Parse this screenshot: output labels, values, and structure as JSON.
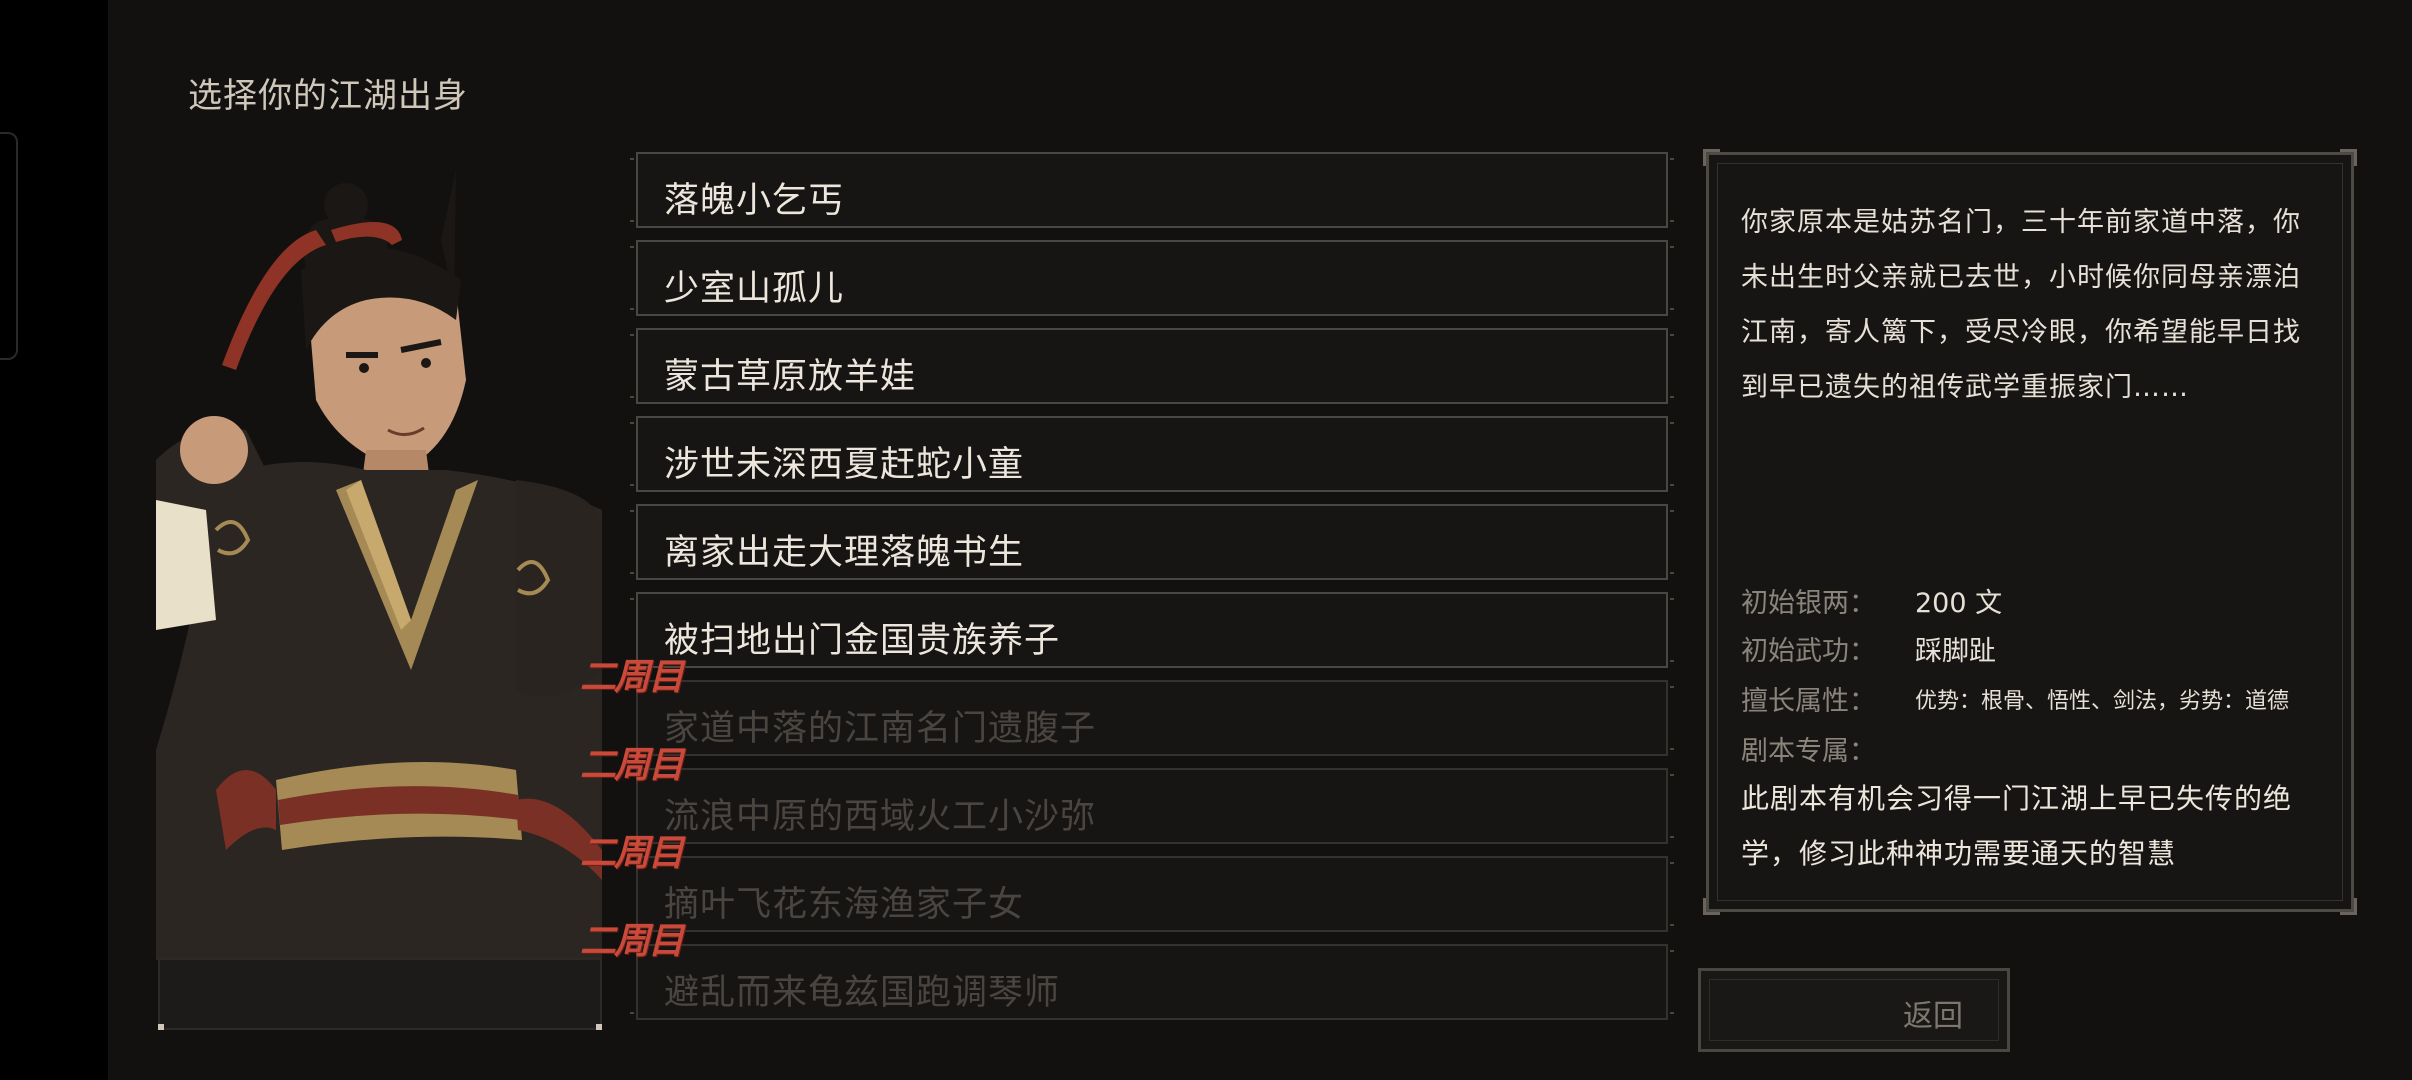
{
  "screen": {
    "title": "选择你的江湖出身"
  },
  "origins": [
    {
      "label": "落魄小乞丐",
      "locked": false,
      "badge": ""
    },
    {
      "label": "少室山孤儿",
      "locked": false,
      "badge": ""
    },
    {
      "label": "蒙古草原放羊娃",
      "locked": false,
      "badge": ""
    },
    {
      "label": "涉世未深西夏赶蛇小童",
      "locked": false,
      "badge": ""
    },
    {
      "label": "离家出走大理落魄书生",
      "locked": false,
      "badge": ""
    },
    {
      "label": "被扫地出门金国贵族养子",
      "locked": false,
      "badge": ""
    },
    {
      "label": "家道中落的江南名门遗腹子",
      "locked": true,
      "badge": "二周目"
    },
    {
      "label": "流浪中原的西域火工小沙弥",
      "locked": true,
      "badge": "二周目"
    },
    {
      "label": "摘叶飞花东海渔家子女",
      "locked": true,
      "badge": "二周目"
    },
    {
      "label": "避乱而来龟兹国跑调琴师",
      "locked": true,
      "badge": "二周目"
    }
  ],
  "detail": {
    "description": "你家原本是姑苏名门，三十年前家道中落，你未出生时父亲就已去世，小时候你同母亲漂泊江南，寄人篱下，受尽冷眼，你希望能早日找到早已遗失的祖传武学重振家门……",
    "stats": [
      {
        "label": "初始银两：",
        "value": "200 文"
      },
      {
        "label": "初始武功：",
        "value": "踩脚趾"
      },
      {
        "label": "擅长属性：",
        "value": "优势：根骨、悟性、剑法，劣势：道德"
      },
      {
        "label": "剧本专属：",
        "value": ""
      }
    ],
    "exclusive": "此剧本有机会习得一门江湖上早已失传的绝学，修习此种神功需要通天的智慧"
  },
  "buttons": {
    "back_label": "返回"
  },
  "colors": {
    "background": "#131110",
    "badge": "#c94a3a",
    "border": "#4a4641"
  }
}
